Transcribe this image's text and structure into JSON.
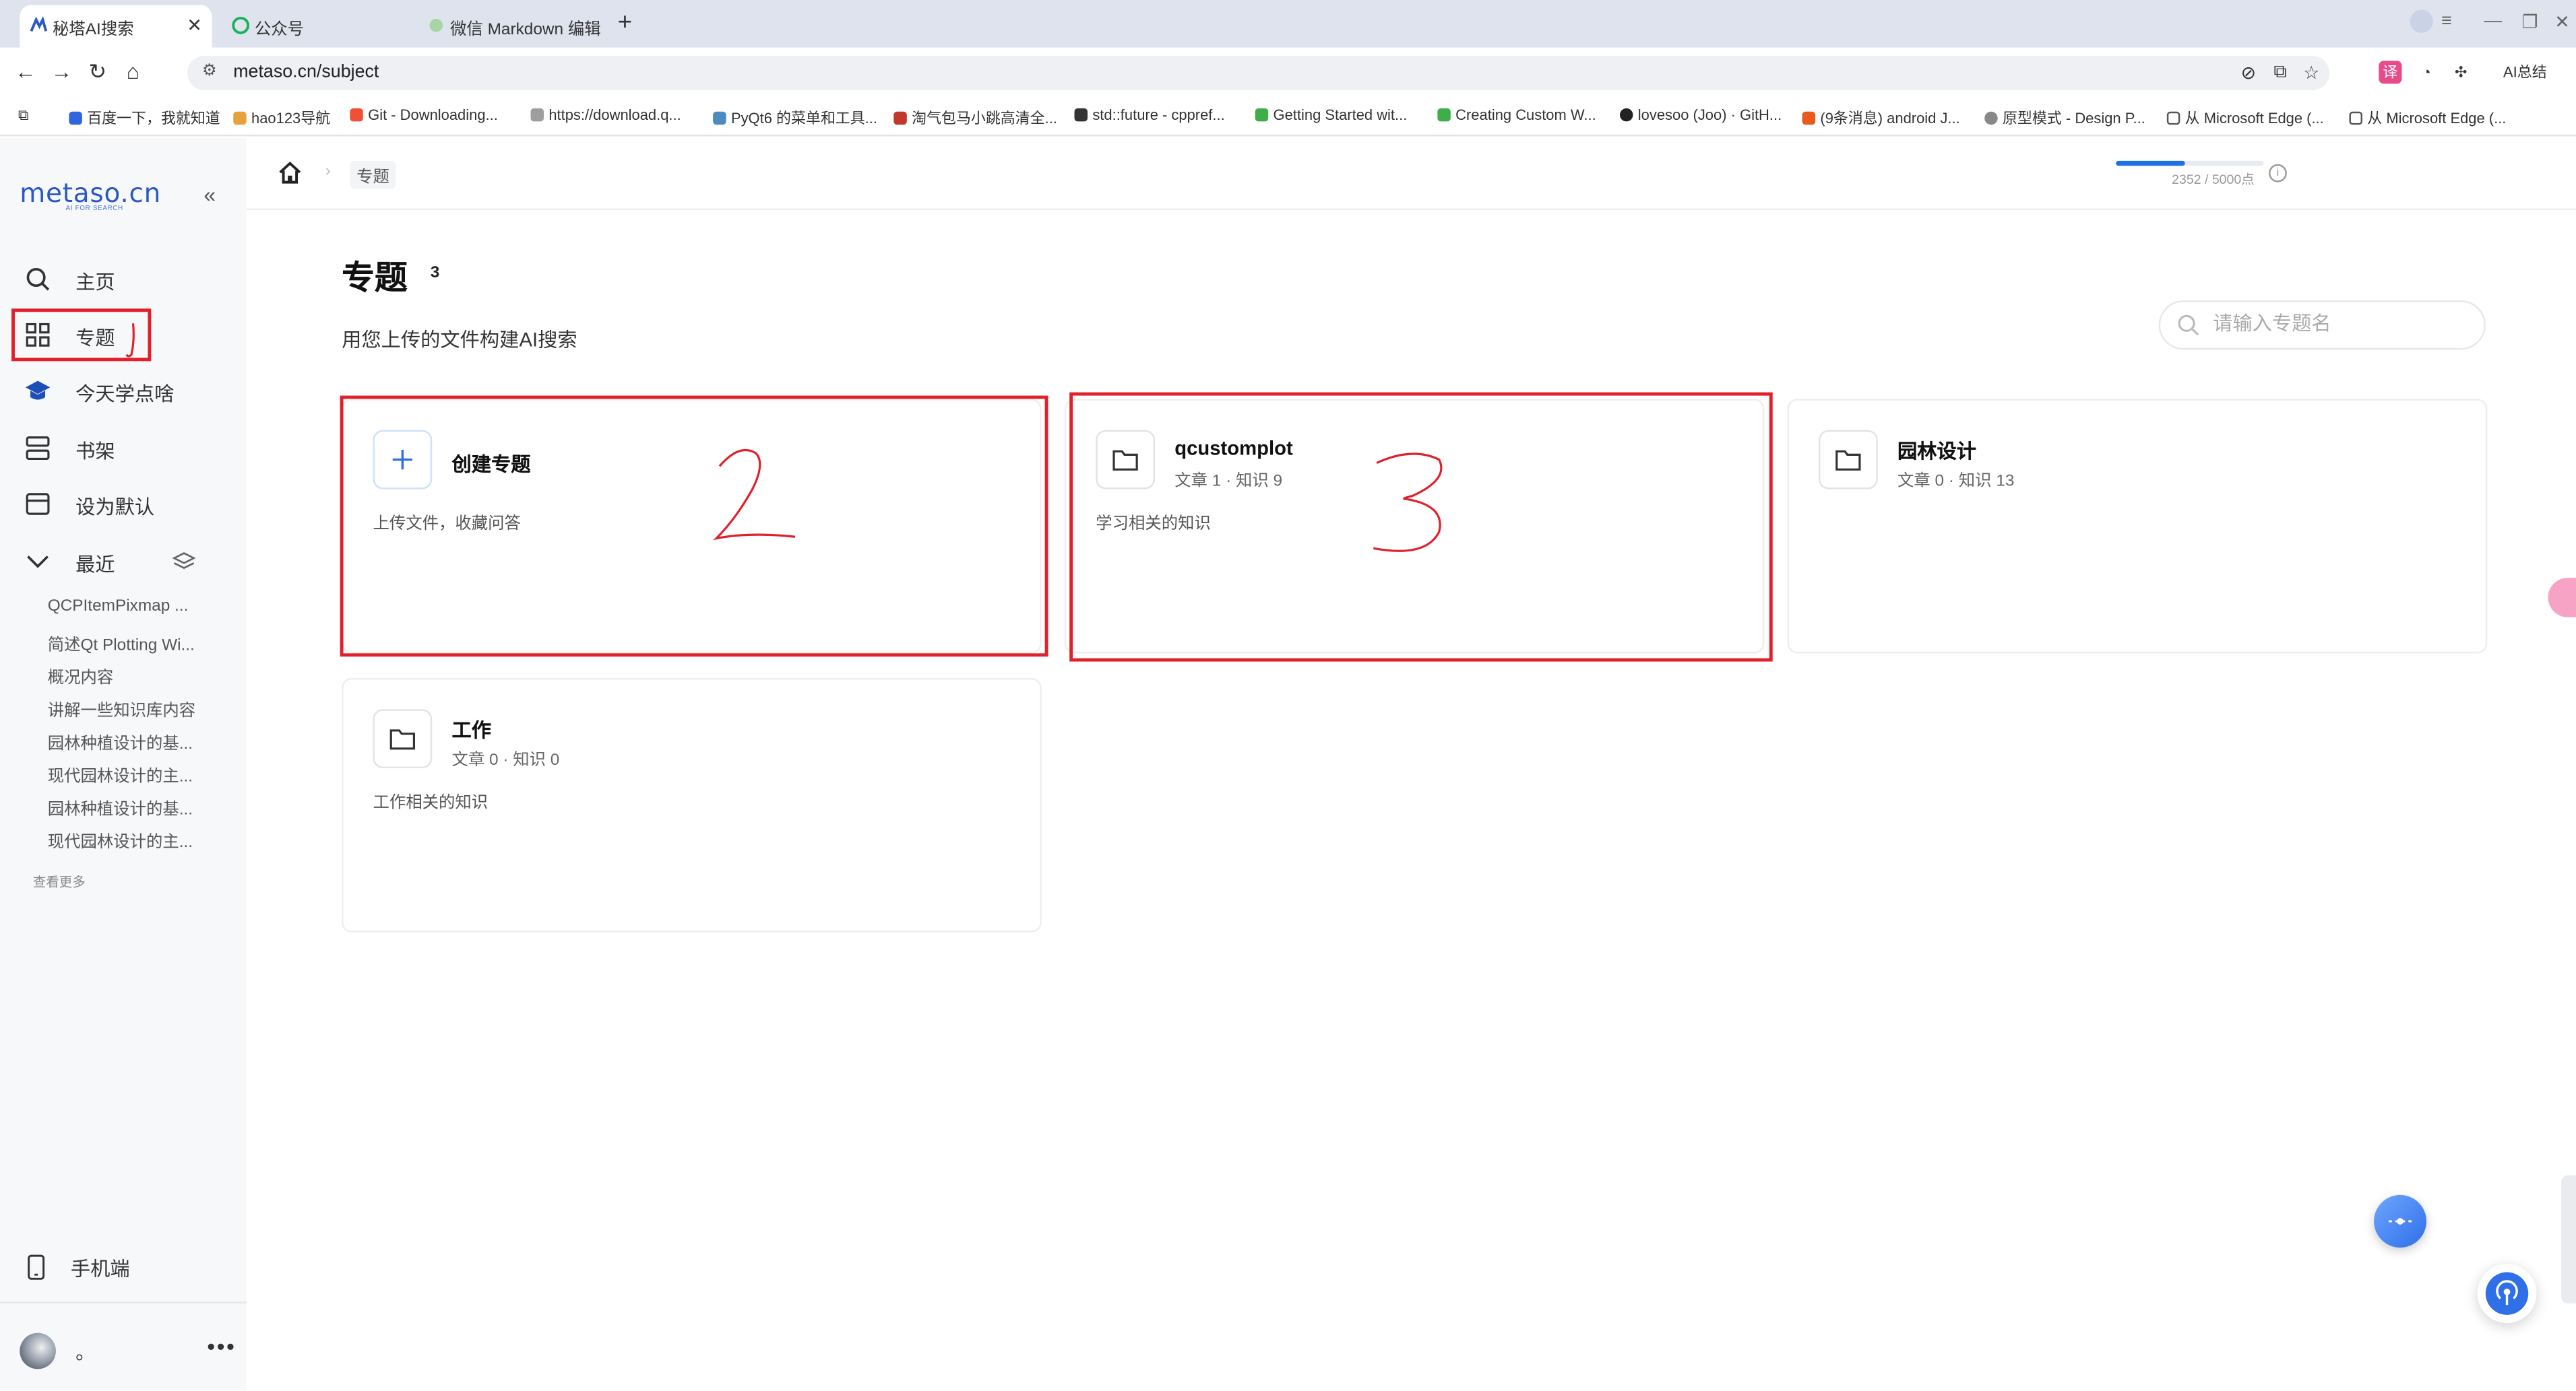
{
  "browser": {
    "tabs": [
      {
        "label": "秘塔AI搜索",
        "active": true
      },
      {
        "label": "公众号",
        "active": false
      },
      {
        "label": "微信 Markdown 编辑",
        "active": false
      }
    ],
    "url": "metaso.cn/subject",
    "bookmarks": [
      "百度一下，我就知道",
      "hao123导航",
      "Git - Downloading...",
      "https://download.q...",
      "PyQt6 的菜单和工具...",
      "淘气包马小跳高清全...",
      "std::future - cppref...",
      "Getting Started wit...",
      "Creating Custom W...",
      "lovesoo (Joo) · GitH...",
      "(9条消息) android J...",
      "原型模式 - Design P...",
      "从 Microsoft Edge (...",
      "从 Microsoft Edge (..."
    ],
    "ai_summary": "AI总结"
  },
  "sidebar": {
    "logo": "metaso.cn",
    "logo_sub": "AI FOR SEARCH",
    "nav": [
      {
        "label": "主页",
        "icon": "search-icon"
      },
      {
        "label": "专题",
        "icon": "grid-icon"
      },
      {
        "label": "今天学点啥",
        "icon": "graduation-cap-icon"
      },
      {
        "label": "书架",
        "icon": "bookshelf-icon"
      },
      {
        "label": "设为默认",
        "icon": "browser-window-icon"
      },
      {
        "label": "最近",
        "icon": "chevron-down-icon"
      }
    ],
    "recent": [
      "QCPItemPixmap ...",
      "简述Qt Plotting Wi...",
      "概况内容",
      "讲解一些知识库内容",
      "园林种植设计的基...",
      "现代园林设计的主...",
      "园林种植设计的基...",
      "现代园林设计的主..."
    ],
    "more": "查看更多",
    "mobile": "手机端",
    "user_name": "。"
  },
  "header": {
    "breadcrumb_current": "专题",
    "quota_text": "2352 / 5000点",
    "quota_fraction": 0.4704
  },
  "main": {
    "title": "专题",
    "count": "3",
    "subtitle": "用您上传的文件构建AI搜索",
    "search_placeholder": "请输入专题名",
    "create_card": {
      "title": "创建专题",
      "desc": "上传文件，收藏问答"
    },
    "topics": [
      {
        "name": "qcustomplot",
        "articles": "文章 1",
        "knowledge": "知识 9",
        "desc": "学习相关的知识"
      },
      {
        "name": "园林设计",
        "articles": "文章 0",
        "knowledge": "知识 13",
        "desc": ""
      },
      {
        "name": "工作",
        "articles": "文章 0",
        "knowledge": "知识 0",
        "desc": "工作相关的知识"
      }
    ]
  },
  "annotations": [
    "1",
    "2",
    "3"
  ],
  "colors": {
    "accent": "#2b59c3",
    "annotation": "#e0202a",
    "quota": "#1f6fe5"
  }
}
